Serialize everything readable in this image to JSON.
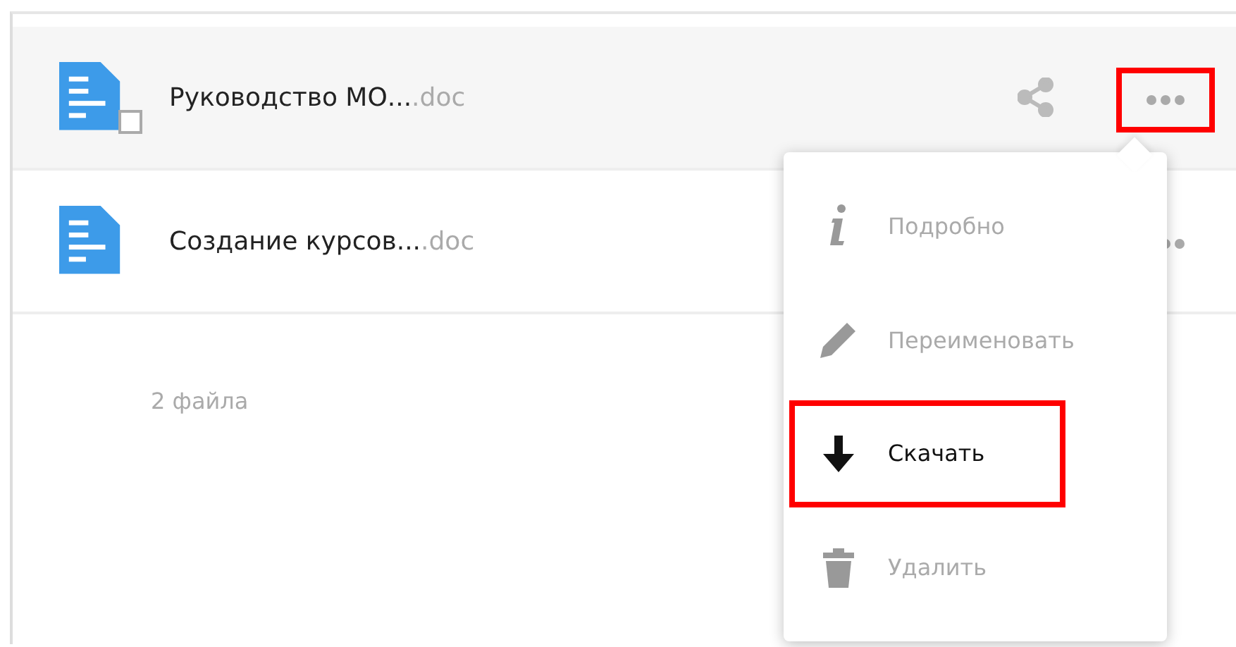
{
  "files": [
    {
      "name": "Руководство МО...",
      "extension": ".doc",
      "hovered": true,
      "checked": false,
      "more_highlighted": true
    },
    {
      "name": "Создание курсов...",
      "extension": ".doc",
      "hovered": false,
      "more_highlighted": false
    }
  ],
  "file_count": "2 файла",
  "context_menu": {
    "items": [
      {
        "label": "Подробно",
        "highlighted": false
      },
      {
        "label": "Переименовать",
        "highlighted": false
      },
      {
        "label": "Скачать",
        "highlighted": true
      },
      {
        "label": "Удалить",
        "highlighted": false
      }
    ]
  }
}
